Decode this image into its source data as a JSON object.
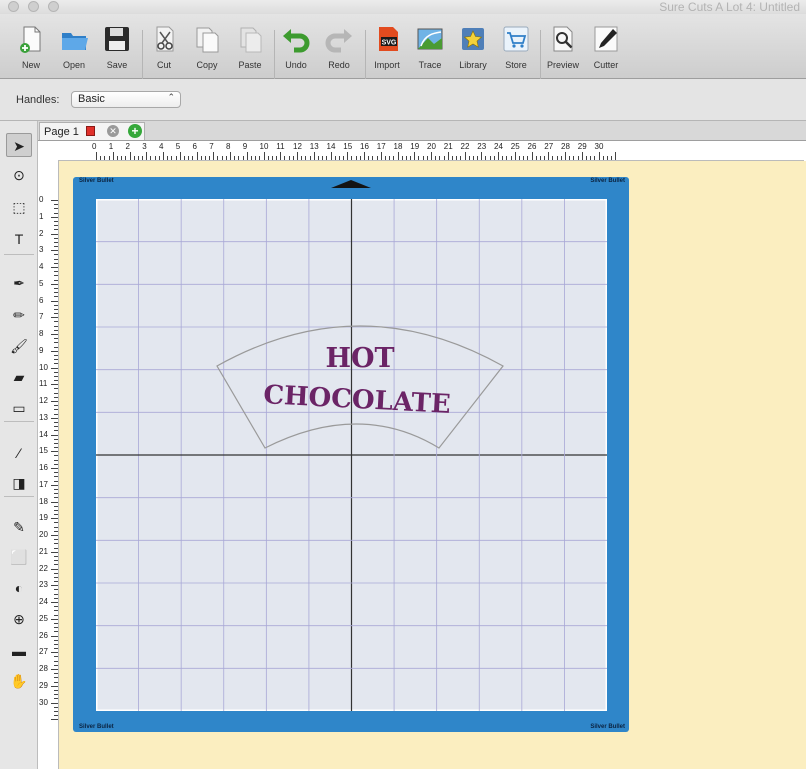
{
  "window": {
    "title": "Sure Cuts A Lot 4: Untitled"
  },
  "toolbar": {
    "items": [
      {
        "label": "New",
        "icon": "new-document-icon"
      },
      {
        "label": "Open",
        "icon": "folder-icon"
      },
      {
        "label": "Save",
        "icon": "floppy-icon"
      },
      {
        "label": "Cut",
        "icon": "scissors-icon"
      },
      {
        "label": "Copy",
        "icon": "copy-icon"
      },
      {
        "label": "Paste",
        "icon": "paste-icon"
      },
      {
        "label": "Undo",
        "icon": "undo-arrow-icon"
      },
      {
        "label": "Redo",
        "icon": "redo-arrow-icon"
      },
      {
        "label": "Import",
        "icon": "svg-import-icon"
      },
      {
        "label": "Trace",
        "icon": "trace-image-icon"
      },
      {
        "label": "Library",
        "icon": "star-library-icon"
      },
      {
        "label": "Store",
        "icon": "shopping-cart-icon"
      },
      {
        "label": "Preview",
        "icon": "magnifier-preview-icon"
      },
      {
        "label": "Cutter",
        "icon": "blade-cutter-icon"
      }
    ]
  },
  "options": {
    "handles_label": "Handles:",
    "handles_value": "Basic"
  },
  "tools": [
    {
      "name": "select-arrow-icon",
      "glyph": "➤",
      "active": true
    },
    {
      "name": "lasso-icon",
      "glyph": "⊙"
    },
    {
      "name": "node-edit-icon",
      "glyph": "⬚"
    },
    {
      "name": "text-tool-icon",
      "glyph": "T"
    },
    {
      "name": "pen-tool-icon",
      "glyph": "✒"
    },
    {
      "name": "pencil-icon",
      "glyph": "✏"
    },
    {
      "name": "brush-icon",
      "glyph": "🖌"
    },
    {
      "name": "eraser-icon",
      "glyph": "▰"
    },
    {
      "name": "rectangle-tool-icon",
      "glyph": "▭"
    },
    {
      "name": "eyedropper-icon",
      "glyph": "⁄"
    },
    {
      "name": "gradient-icon",
      "glyph": "◨"
    },
    {
      "name": "knife-icon",
      "glyph": "✎"
    },
    {
      "name": "transform-icon",
      "glyph": "⬜"
    },
    {
      "name": "flip-icon",
      "glyph": "◐"
    },
    {
      "name": "zoom-icon",
      "glyph": "⊕"
    },
    {
      "name": "measure-ruler-icon",
      "glyph": "▬"
    },
    {
      "name": "hand-pan-icon",
      "glyph": "✋"
    }
  ],
  "tab": {
    "label": "Page 1"
  },
  "ruler": {
    "h_numbers": [
      "0",
      "1",
      "2",
      "3",
      "4",
      "5",
      "6",
      "7",
      "8",
      "9",
      "10",
      "11",
      "12",
      "13",
      "14",
      "15",
      "16",
      "17",
      "18",
      "19",
      "20",
      "21",
      "22",
      "23",
      "24",
      "25",
      "26",
      "27",
      "28",
      "29",
      "30"
    ],
    "v_numbers": [
      "0",
      "1",
      "2",
      "3",
      "4",
      "5",
      "6",
      "7",
      "8",
      "9",
      "10",
      "11",
      "12",
      "13",
      "14",
      "15",
      "16",
      "17",
      "18",
      "19",
      "20",
      "21",
      "22",
      "23",
      "24",
      "25",
      "26",
      "27",
      "28",
      "29",
      "30"
    ]
  },
  "mat": {
    "brand_tl": "Silver Bullet",
    "brand_tr": "Silver Bullet",
    "brand_bl": "Silver Bullet",
    "brand_br": "Silver Bullet"
  },
  "design": {
    "line1": "HOT",
    "line2": "CHOCOLATE",
    "text_color": "#6b2466"
  },
  "colors": {
    "mat_blue": "#2f86c9",
    "canvas_bg": "#fbeec0",
    "grid_bg": "#e3e7ef",
    "grid_line": "#a9a8d6"
  }
}
